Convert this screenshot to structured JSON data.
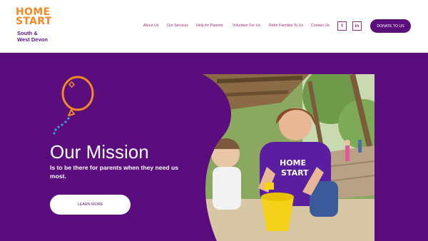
{
  "logo": {
    "word1": "HOME",
    "word2": "START",
    "line1": "South &",
    "line2": "West Devon"
  },
  "nav": {
    "items": [
      {
        "label": "About Us"
      },
      {
        "label": "Our Services"
      },
      {
        "label": "Help for Parents"
      },
      {
        "label": "Volunteer For Us"
      },
      {
        "label": "Refer Families To Us"
      },
      {
        "label": "Contact Us"
      }
    ],
    "facebook": "f",
    "linkedin": "in",
    "donate_label": "DONATE TO US"
  },
  "hero": {
    "title": "Our Mission",
    "text": "Is to be there for parents when they need us most.",
    "button_label": "LEARN MORE",
    "shirt_logo_line1": "HOME",
    "shirt_logo_line2": "START"
  },
  "colors": {
    "brand_purple": "#5b0c7d",
    "brand_orange": "#f08a24",
    "nav_pink": "#a0297a",
    "balloon_blue": "#3aa0d8"
  },
  "icons": [
    "facebook-icon",
    "linkedin-icon",
    "balloon-icon"
  ]
}
